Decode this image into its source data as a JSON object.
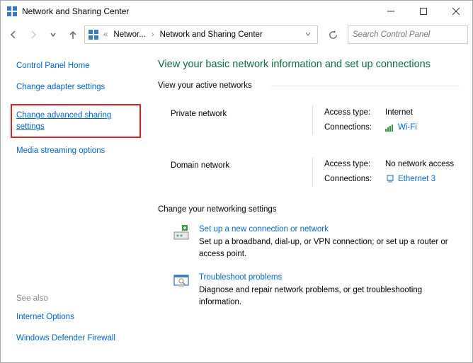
{
  "window": {
    "title": "Network and Sharing Center"
  },
  "breadcrumb": {
    "seg1": "Networ...",
    "seg2": "Network and Sharing Center"
  },
  "search": {
    "placeholder": "Search Control Panel"
  },
  "sidebar": {
    "home": "Control Panel Home",
    "adapter": "Change adapter settings",
    "advanced": "Change advanced sharing settings",
    "media": "Media streaming options",
    "seealso": "See also",
    "internet": "Internet Options",
    "firewall": "Windows Defender Firewall"
  },
  "main": {
    "heading": "View your basic network information and set up connections",
    "active_title": "View your active networks",
    "networks": [
      {
        "name": "Private network",
        "access_label": "Access type:",
        "access_value": "Internet",
        "conn_label": "Connections:",
        "conn_name": "Wi-Fi",
        "conn_icon": "wifi"
      },
      {
        "name": "Domain network",
        "access_label": "Access type:",
        "access_value": "No network access",
        "conn_label": "Connections:",
        "conn_name": "Ethernet 3",
        "conn_icon": "ethernet"
      }
    ],
    "change_title": "Change your networking settings",
    "setup": {
      "link": "Set up a new connection or network",
      "desc": "Set up a broadband, dial-up, or VPN connection; or set up a router or access point."
    },
    "troubleshoot": {
      "link": "Troubleshoot problems",
      "desc": "Diagnose and repair network problems, or get troubleshooting information."
    }
  }
}
